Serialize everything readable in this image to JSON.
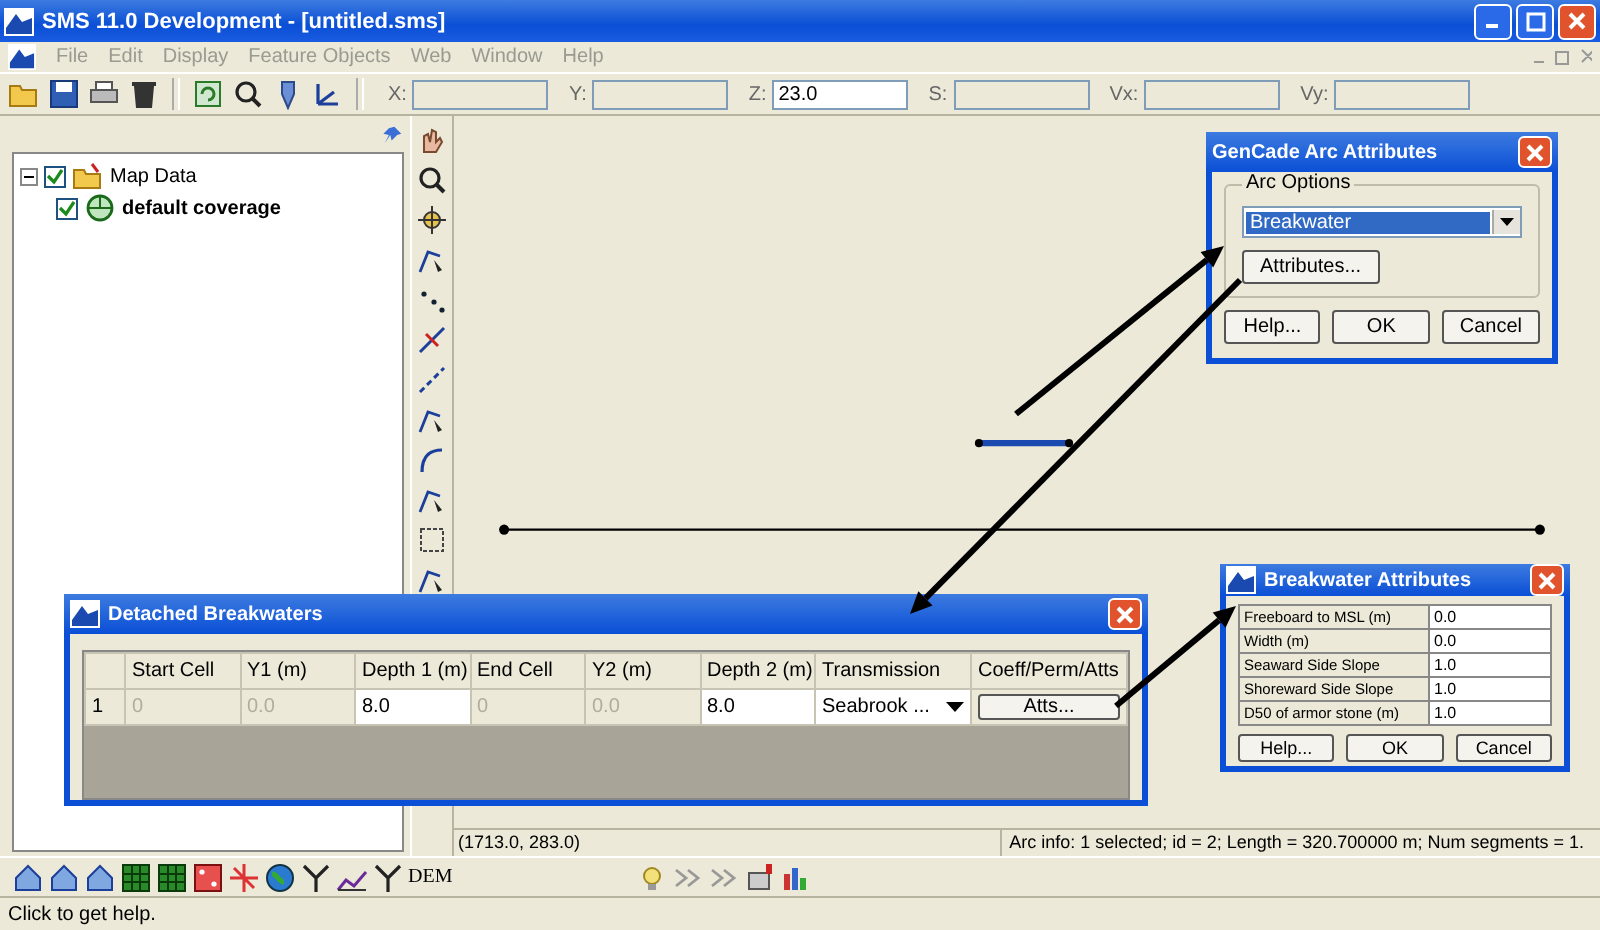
{
  "window": {
    "title": "SMS 11.0 Development - [untitled.sms]"
  },
  "menu": [
    {
      "label": "File",
      "disabled": true
    },
    {
      "label": "Edit",
      "disabled": true
    },
    {
      "label": "Display",
      "disabled": true
    },
    {
      "label": "Feature Objects",
      "disabled": true
    },
    {
      "label": "Web",
      "disabled": true
    },
    {
      "label": "Window",
      "disabled": true
    },
    {
      "label": "Help",
      "disabled": true
    }
  ],
  "coord_fields": [
    {
      "label": "X:"
    },
    {
      "label": "Y:"
    },
    {
      "label": "Z:",
      "value": "23.0"
    },
    {
      "label": "S:"
    },
    {
      "label": "Vx:"
    },
    {
      "label": "Vy:"
    }
  ],
  "tree": [
    {
      "label": "Map Data",
      "checked": true,
      "expanded": true,
      "children": [
        {
          "label": "default coverage",
          "checked": true
        }
      ]
    }
  ],
  "coordinates": "(1713.0, 283.0)",
  "arc_info": "Arc info: 1 selected; id = 2; Length = 320.700000 m; Num segments = 1.",
  "status_bar": "Click to get help.",
  "bottom_tool_labels": [
    "DEM"
  ],
  "gencade_dialog": {
    "title": "GenCade Arc Attributes",
    "group": "Arc Options",
    "option": "Breakwater",
    "attributes_button": "Attributes...",
    "buttons": [
      "Help...",
      "OK",
      "Cancel"
    ]
  },
  "breakwaters_dialog": {
    "title": "Detached Breakwaters",
    "columns": [
      "Start Cell",
      "Y1 (m)",
      "Depth 1 (m)",
      "End Cell",
      "Y2 (m)",
      "Depth 2 (m)",
      "Transmission",
      "Coeff/Perm/Atts"
    ],
    "rows": [
      {
        "index": "1",
        "cells": [
          {
            "kind": "text",
            "value": "0",
            "disabled": true
          },
          {
            "kind": "text",
            "value": "0.0",
            "disabled": true
          },
          {
            "kind": "text",
            "value": "8.0",
            "disabled": false
          },
          {
            "kind": "text",
            "value": "0",
            "disabled": true
          },
          {
            "kind": "text",
            "value": "0.0",
            "disabled": true
          },
          {
            "kind": "text",
            "value": "8.0",
            "disabled": false
          },
          {
            "kind": "dropdown",
            "value": "Seabrook ..."
          },
          {
            "kind": "button",
            "value": "Atts..."
          }
        ]
      }
    ]
  },
  "attributes_dialog": {
    "title": "Breakwater Attributes",
    "rows": [
      {
        "label": "Freeboard to MSL (m)",
        "value": "0.0"
      },
      {
        "label": "Width (m)",
        "value": "0.0"
      },
      {
        "label": "Seaward Side Slope",
        "value": "1.0"
      },
      {
        "label": "Shoreward Side Slope",
        "value": "1.0"
      },
      {
        "label": "D50 of armor stone (m)",
        "value": "1.0"
      }
    ],
    "buttons": [
      "Help...",
      "OK",
      "Cancel"
    ]
  }
}
